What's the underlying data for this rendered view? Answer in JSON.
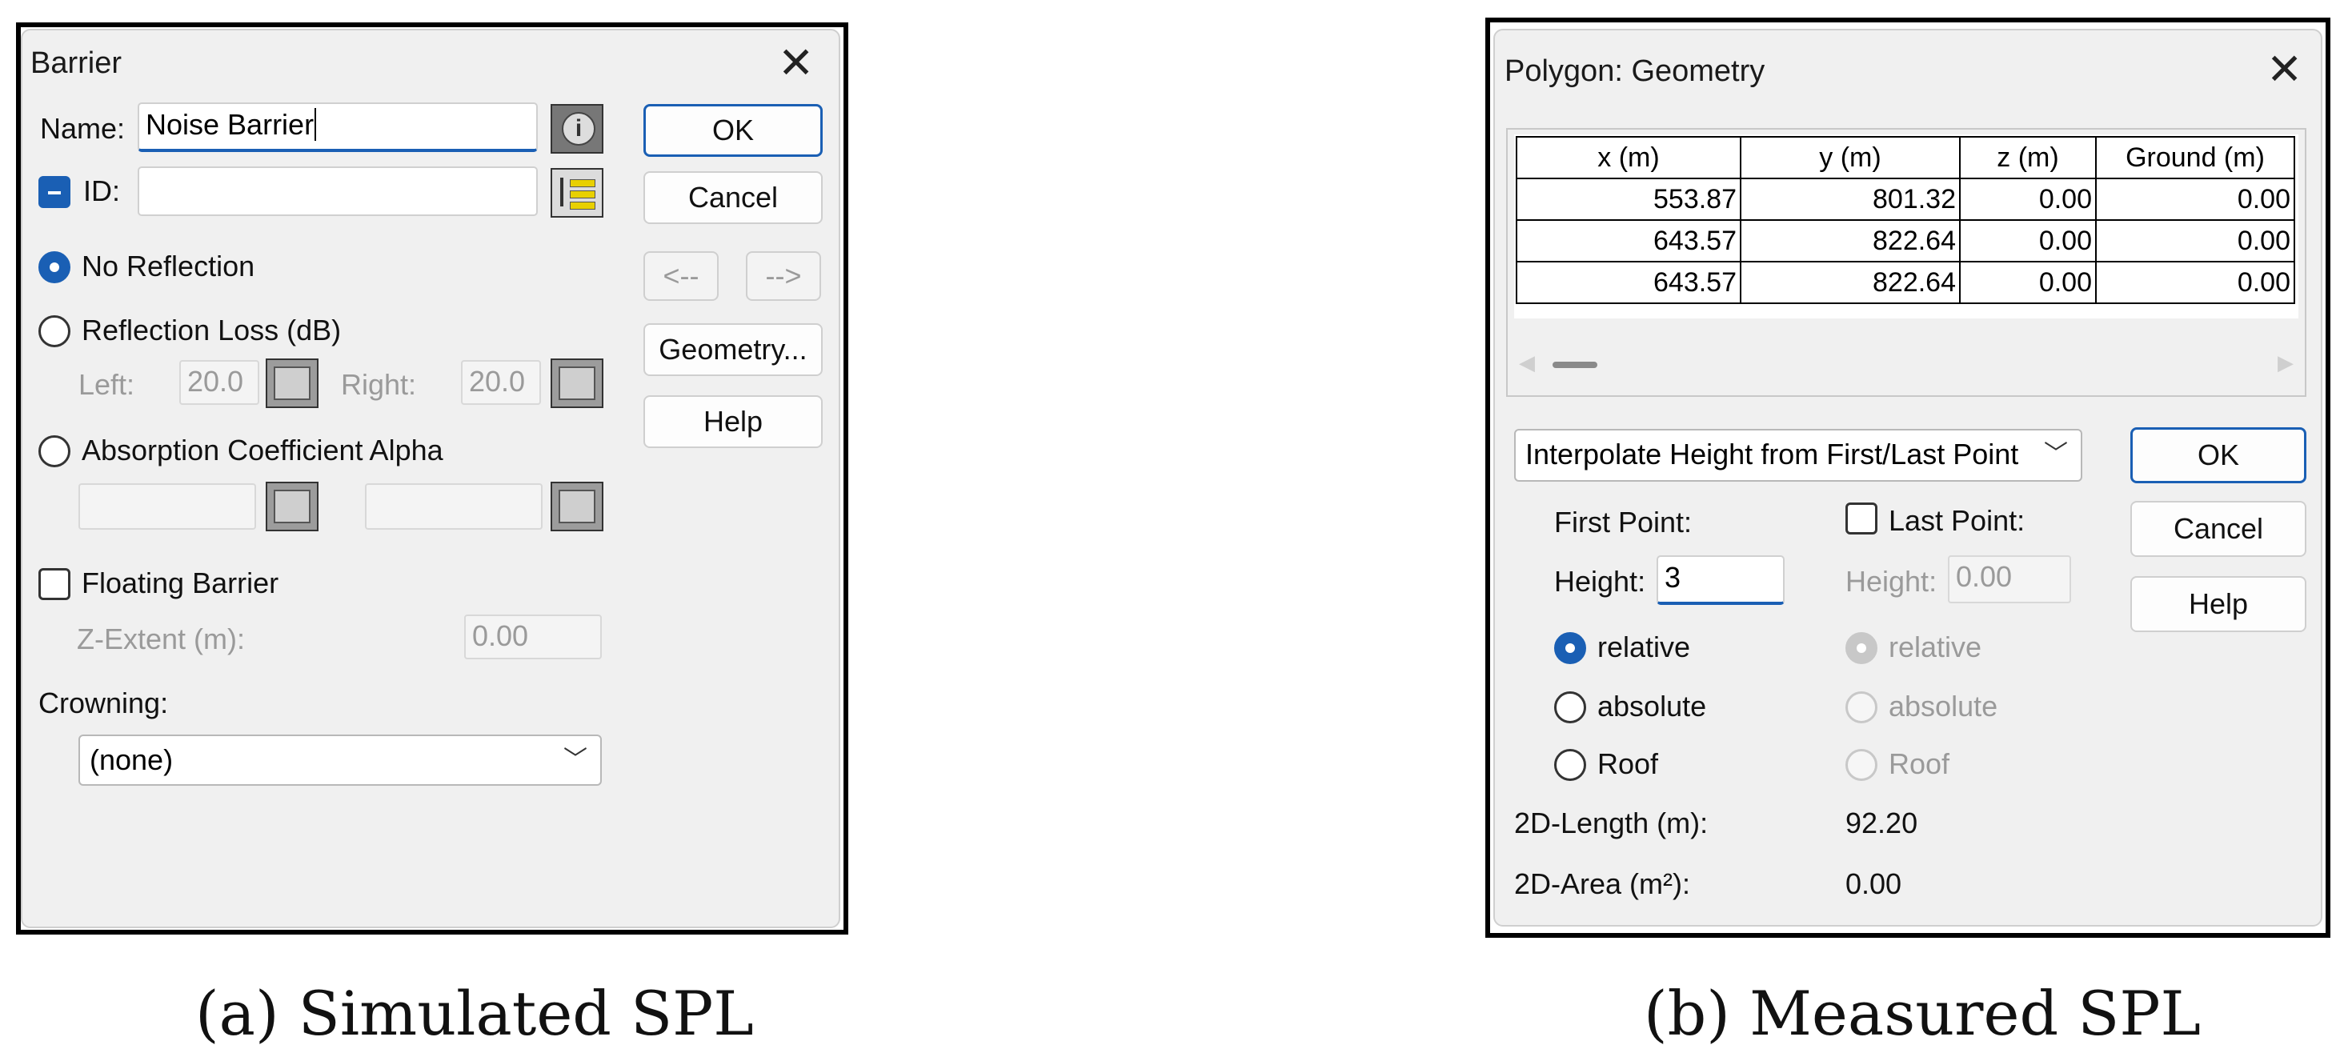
{
  "barrier": {
    "title": "Barrier",
    "name_label": "Name:",
    "name_value": "Noise Barrier",
    "id_label": "ID:",
    "id_value": "",
    "radio_no_reflection": "No Reflection",
    "radio_reflection_loss": "Reflection Loss (dB)",
    "left_label": "Left:",
    "left_value": "20.0",
    "right_label": "Right:",
    "right_value": "20.0",
    "radio_absorption": "Absorption Coefficient Alpha",
    "floating_label": "Floating Barrier",
    "zextent_label": "Z-Extent (m):",
    "zextent_value": "0.00",
    "crowning_label": "Crowning:",
    "crowning_value": "(none)",
    "ok": "OK",
    "cancel": "Cancel",
    "prev": "<--",
    "next": "-->",
    "geometry": "Geometry...",
    "help": "Help"
  },
  "polygon": {
    "title": "Polygon: Geometry",
    "columns": [
      "x (m)",
      "y (m)",
      "z (m)",
      "Ground (m)"
    ],
    "rows": [
      [
        "553.87",
        "801.32",
        "0.00",
        "0.00"
      ],
      [
        "643.57",
        "822.64",
        "0.00",
        "0.00"
      ],
      [
        "643.57",
        "822.64",
        "0.00",
        "0.00"
      ]
    ],
    "interp_value": "Interpolate Height from First/Last Point",
    "first_point": "First Point:",
    "last_point": "Last Point:",
    "height_label": "Height:",
    "height_first": "3",
    "height_last": "0.00",
    "relative": "relative",
    "absolute": "absolute",
    "roof": "Roof",
    "length_label": "2D-Length (m):",
    "length_value": "92.20",
    "area_label": "2D-Area (m²):",
    "area_value": "0.00",
    "ok": "OK",
    "cancel": "Cancel",
    "help": "Help"
  },
  "captions": {
    "a": "(a) Simulated SPL",
    "b": "(b) Measured SPL"
  },
  "colors": {
    "accent": "#1a5fb4",
    "dialog_bg": "#f0f0f0"
  }
}
